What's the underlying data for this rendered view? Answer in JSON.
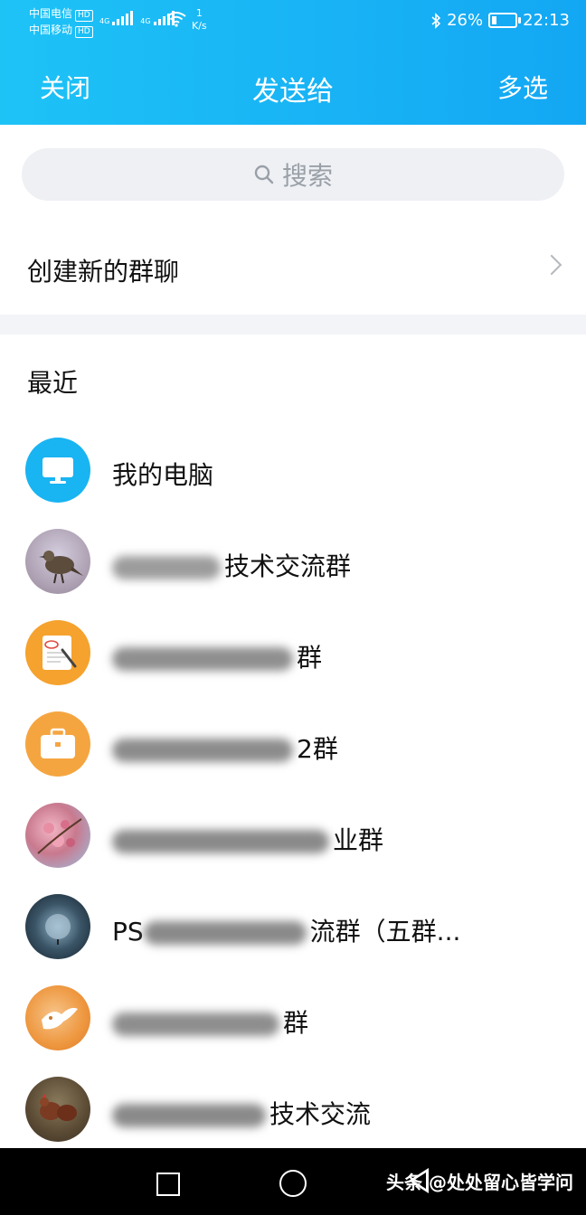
{
  "status_bar": {
    "carrier1": "中国电信",
    "carrier2": "中国移动",
    "hd": "HD",
    "net1": "4G",
    "net2": "4G",
    "speed_value": "1",
    "speed_unit": "K/s",
    "battery": "26%",
    "time": "22:13"
  },
  "header": {
    "close_label": "关闭",
    "title": "发送给",
    "multi_label": "多选"
  },
  "search": {
    "placeholder": "搜索"
  },
  "create_group": {
    "label": "创建新的群聊"
  },
  "recent": {
    "title": "最近",
    "items": [
      {
        "name": "我的电脑",
        "avatar": "computer"
      },
      {
        "name": "技术交流群",
        "avatar": "bird-photo"
      },
      {
        "name": "群",
        "avatar": "notepad"
      },
      {
        "name": "2群",
        "avatar": "briefcase"
      },
      {
        "name": "业群",
        "avatar": "blossom-photo"
      },
      {
        "name": "流群（五群...",
        "prefix": "PS",
        "avatar": "planet-photo"
      },
      {
        "name": "群",
        "avatar": "dove-photo"
      },
      {
        "name": "技术交流",
        "avatar": "chicken-photo"
      }
    ]
  },
  "watermark": "头条 @处处留心皆学问",
  "colors": {
    "header_start": "#1ec3f6",
    "header_end": "#13a7f3",
    "accent": "#1ab0f6"
  }
}
